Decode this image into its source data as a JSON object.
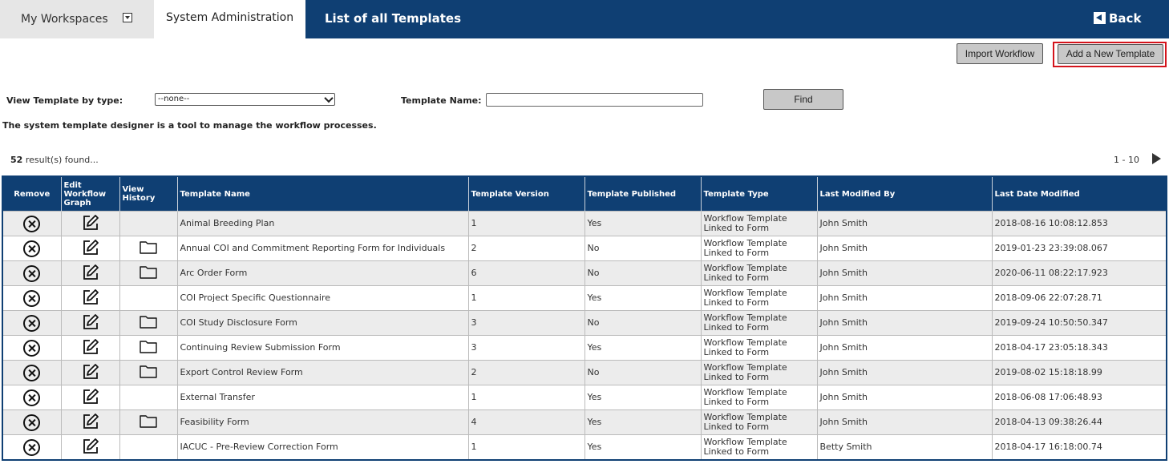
{
  "header": {
    "workspaces_label": "My Workspaces",
    "sysadmin_label": "System Administration",
    "page_title": "List of all Templates",
    "back_label": "Back"
  },
  "toolbar": {
    "import_label": "Import Workflow",
    "add_label": "Add a New Template",
    "find_label": "Find"
  },
  "filter": {
    "type_label": "View Template by type:",
    "type_value": "--none--",
    "name_label": "Template Name:",
    "name_value": ""
  },
  "description": "The system template designer is a tool to manage the workflow processes.",
  "results": {
    "count": "52",
    "suffix": "result(s) found...",
    "range": "1 - 10"
  },
  "table": {
    "headers": [
      "Remove",
      "Edit Workflow Graph",
      "View History",
      "Template Name",
      "Template Version",
      "Template Published",
      "Template Type",
      "Last Modified By",
      "Last Date Modified"
    ],
    "rows": [
      {
        "name": "Animal Breeding Plan",
        "version": "1",
        "published": "Yes",
        "type": "Workflow Template Linked to Form",
        "by": "John Smith",
        "date": "2018-08-16 10:08:12.853",
        "history": false
      },
      {
        "name": "Annual COI and Commitment Reporting Form for Individuals",
        "version": "2",
        "published": "No",
        "type": "Workflow Template Linked to Form",
        "by": "John Smith",
        "date": "2019-01-23 23:39:08.067",
        "history": true
      },
      {
        "name": "Arc Order Form",
        "version": "6",
        "published": "No",
        "type": "Workflow Template Linked to Form",
        "by": "John Smith",
        "date": "2020-06-11 08:22:17.923",
        "history": true
      },
      {
        "name": "COI Project Specific Questionnaire",
        "version": "1",
        "published": "Yes",
        "type": "Workflow Template Linked to Form",
        "by": "John Smith",
        "date": "2018-09-06 22:07:28.71",
        "history": false
      },
      {
        "name": "COI Study Disclosure Form",
        "version": "3",
        "published": "No",
        "type": "Workflow Template Linked to Form",
        "by": "John Smith",
        "date": "2019-09-24 10:50:50.347",
        "history": true
      },
      {
        "name": "Continuing Review Submission Form",
        "version": "3",
        "published": "Yes",
        "type": "Workflow Template Linked to Form",
        "by": "John Smith",
        "date": "2018-04-17 23:05:18.343",
        "history": true
      },
      {
        "name": "Export Control Review Form",
        "version": "2",
        "published": "No",
        "type": "Workflow Template Linked to Form",
        "by": "John Smith",
        "date": "2019-08-02 15:18:18.99",
        "history": true
      },
      {
        "name": "External Transfer",
        "version": "1",
        "published": "Yes",
        "type": "Workflow Template Linked to Form",
        "by": "John Smith",
        "date": "2018-06-08 17:06:48.93",
        "history": false
      },
      {
        "name": "Feasibility Form",
        "version": "4",
        "published": "Yes",
        "type": "Workflow Template Linked to Form",
        "by": "John Smith",
        "date": "2018-04-13 09:38:26.44",
        "history": true
      },
      {
        "name": "IACUC - Pre-Review Correction Form",
        "version": "1",
        "published": "Yes",
        "type": "Workflow Template Linked to Form",
        "by": "Betty Smith",
        "date": "2018-04-17 16:18:00.74",
        "history": false
      }
    ]
  }
}
